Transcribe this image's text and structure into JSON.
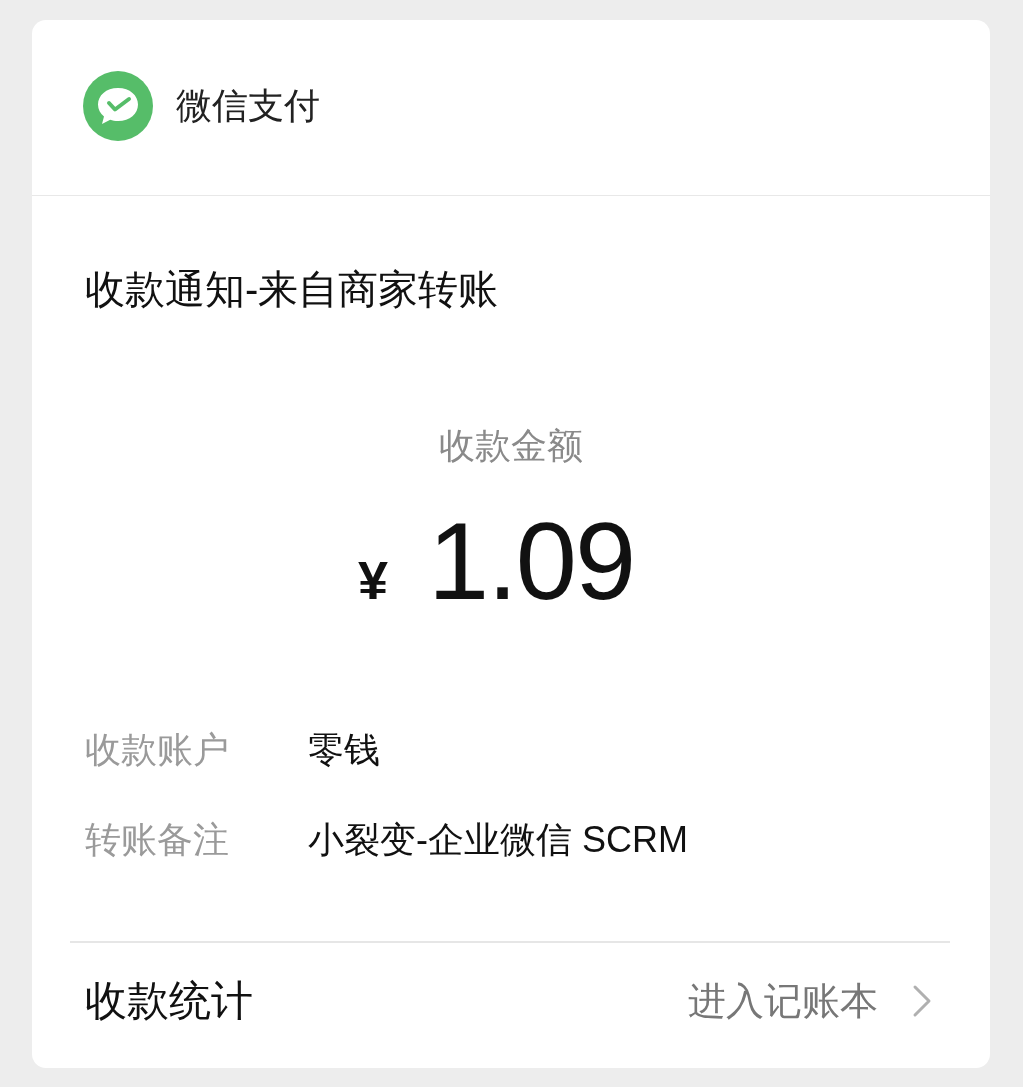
{
  "header": {
    "brand": "微信支付"
  },
  "notice": {
    "title": "收款通知-来自商家转账",
    "amount_label": "收款金额",
    "currency": "¥",
    "amount": "1.09",
    "details": [
      {
        "label": "收款账户",
        "value": "零钱"
      },
      {
        "label": "转账备注",
        "value": "小裂变-企业微信 SCRM"
      }
    ]
  },
  "footer": {
    "label": "收款统计",
    "link": "进入记账本"
  }
}
